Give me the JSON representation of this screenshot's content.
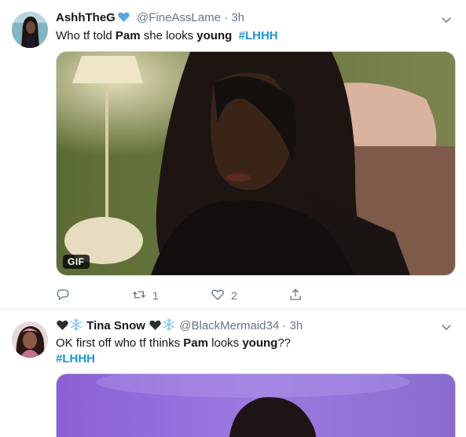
{
  "tweets": [
    {
      "display_name": "AshhTheG",
      "handle": "@FineAssLame",
      "separator": "·",
      "time": "3h",
      "text_parts": [
        "Who tf told ",
        "Pam",
        " she looks ",
        "young",
        "  ",
        "#LHHH"
      ],
      "media_badge": "GIF",
      "reply_count": "",
      "retweet_count": "1",
      "like_count": "2"
    },
    {
      "display_name": "Tina Snow",
      "handle": "@BlackMermaid34",
      "separator": "·",
      "time": "3h",
      "text_parts": [
        "OK first off who tf thinks ",
        "Pam",
        " looks ",
        "young",
        "??"
      ],
      "hashtag": "#LHHH"
    }
  ],
  "icons": {
    "verified": "blue-heart-icon",
    "name_decor": [
      "black-heart-icon",
      "snowflake-icon"
    ],
    "menu": "chevron-down-icon",
    "reply": "reply-icon",
    "retweet": "retweet-icon",
    "like": "heart-icon",
    "share": "share-icon"
  },
  "colors": {
    "accent": "#1b95e0",
    "muted": "#657786",
    "text": "#14171a",
    "verified_heart": "#5ba4e5"
  }
}
